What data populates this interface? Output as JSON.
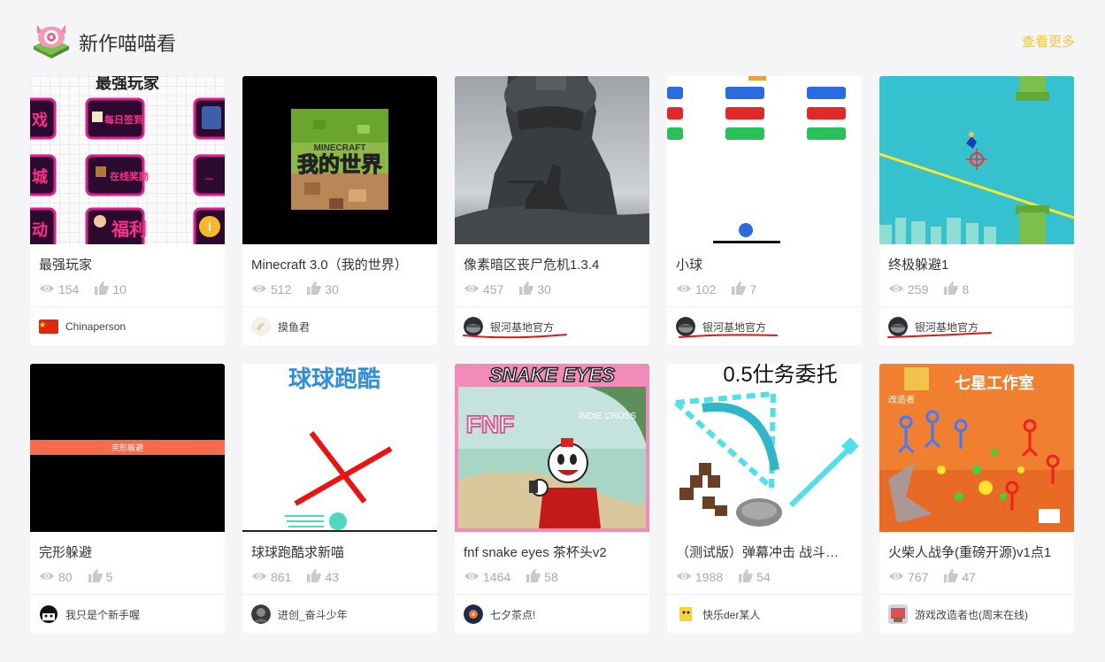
{
  "header": {
    "title": "新作喵喵看",
    "more": "查看更多"
  },
  "cards": [
    {
      "title": "最强玩家",
      "views": "154",
      "likes": "10",
      "author": "Chinaperson",
      "thumb": {
        "heading": "最强玩家",
        "tiles": [
          "戏",
          "每日签到",
          "",
          "城",
          "在线奖励",
          "...",
          "动",
          "福利",
          ""
        ]
      }
    },
    {
      "title": "Minecraft 3.0（我的世界）",
      "views": "512",
      "likes": "30",
      "author": "摸鱼君",
      "thumb": {
        "brand": "MINECRAFT",
        "name": "我的世界"
      }
    },
    {
      "title": "像素暗区丧尸危机1.3.4",
      "views": "457",
      "likes": "30",
      "author": "银河基地官方",
      "thumb": {}
    },
    {
      "title": "小球",
      "views": "102",
      "likes": "7",
      "author": "银河基地官方",
      "thumb": {}
    },
    {
      "title": "终极躲避1",
      "views": "259",
      "likes": "8",
      "author": "银河基地官方",
      "thumb": {}
    },
    {
      "title": "完形躲避",
      "views": "80",
      "likes": "5",
      "author": "我只是个新手喔",
      "thumb": {
        "bar": "完形躲避"
      }
    },
    {
      "title": "球球跑酷求新喵",
      "views": "861",
      "likes": "43",
      "author": "进创_奋斗少年",
      "thumb": {
        "heading": "球球跑酷"
      }
    },
    {
      "title": "fnf snake eyes 茶杯头v2",
      "views": "1464",
      "likes": "58",
      "author": "七夕茶点!",
      "thumb": {
        "heading": "SNAKE EYES",
        "sub": "INDIE CROSS",
        "logo": "FNF"
      }
    },
    {
      "title": "（测试版）弹幕冲击 战斗…",
      "views": "1988",
      "likes": "54",
      "author": "快乐der某人",
      "thumb": {
        "heading": "0.5仕务委托"
      }
    },
    {
      "title": "火柴人战争(重磅开源)v1点1",
      "views": "767",
      "likes": "47",
      "author": "游戏改造者也(周末在线)",
      "thumb": {
        "heading": "七星工作室",
        "sub": "改造者"
      }
    }
  ],
  "colors": {
    "accent": "#f3c64c",
    "underline": "#d91a1a",
    "icon": "#c9c9c9"
  },
  "icons": {
    "views": "eye-icon",
    "likes": "thumbs-up-icon"
  }
}
